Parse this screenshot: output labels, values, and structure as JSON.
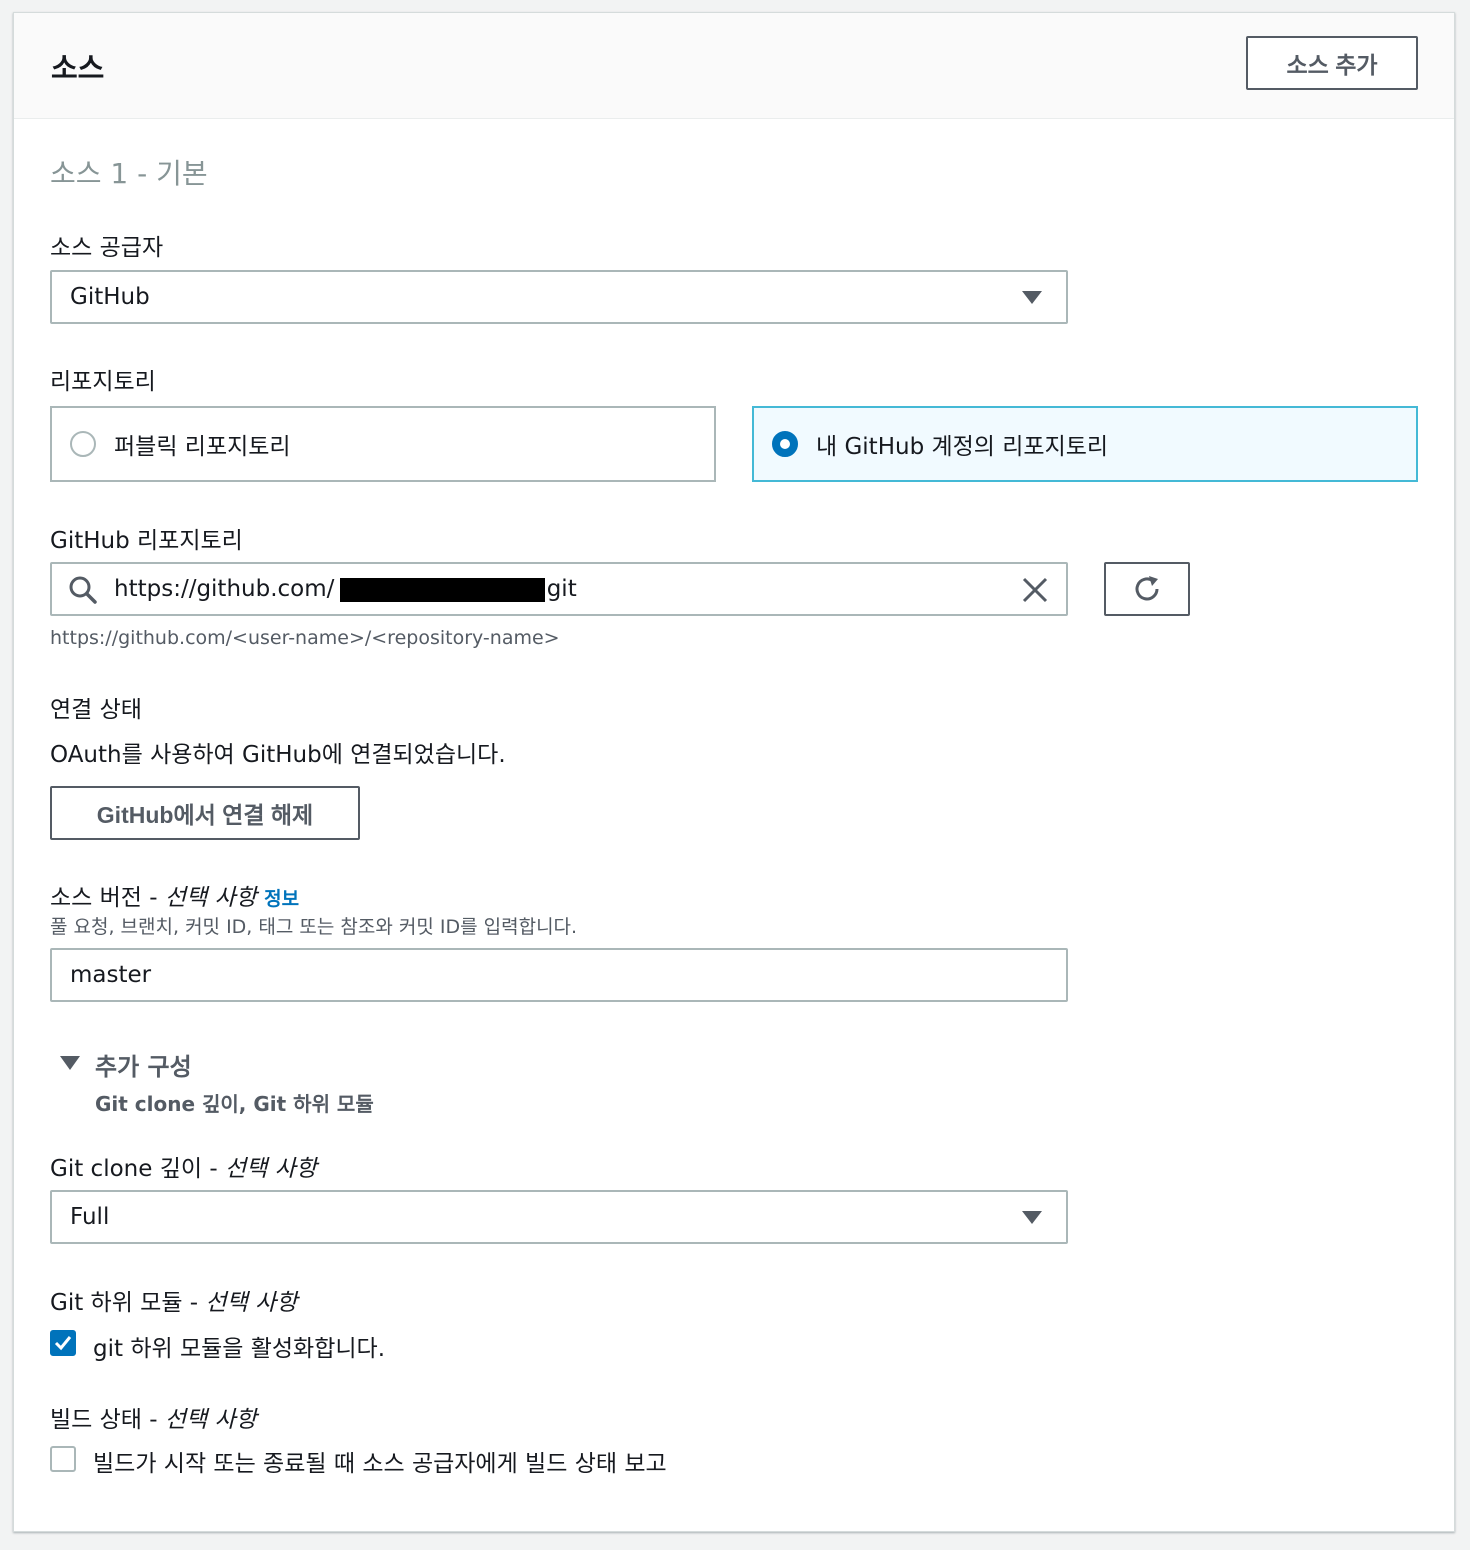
{
  "panel": {
    "title": "소스",
    "add_source_label": "소스 추가"
  },
  "source1": {
    "subtitle": "소스 1 - 기본"
  },
  "provider": {
    "label": "소스 공급자",
    "value": "GitHub"
  },
  "repository": {
    "label": "리포지토리",
    "options": [
      {
        "label": "퍼블릭 리포지토리",
        "selected": false
      },
      {
        "label": "내 GitHub 계정의 리포지토리",
        "selected": true
      }
    ]
  },
  "github_repo": {
    "label": "GitHub 리포지토리",
    "value_prefix": "https://github.com/",
    "value_suffix": ".git",
    "hint": "https://github.com/<user-name>/<repository-name>"
  },
  "connection": {
    "label": "연결 상태",
    "status_text": "OAuth를 사용하여 GitHub에 연결되었습니다.",
    "disconnect_label": "GitHub에서 연결 해제"
  },
  "source_version": {
    "label": "소스 버전 - ",
    "optional": "선택 사항",
    "info_link": "정보",
    "hint": "풀 요청, 브랜치, 커밋 ID, 태그 또는 참조와 커밋 ID를 입력합니다.",
    "value": "master"
  },
  "additional_config": {
    "title": "추가 구성",
    "subtitle": "Git clone 깊이, Git 하위 모듈"
  },
  "clone_depth": {
    "label": "Git clone 깊이 - ",
    "optional": "선택 사항",
    "value": "Full"
  },
  "submodules": {
    "label": "Git 하위 모듈 - ",
    "optional": "선택 사항",
    "checkbox_label": "git 하위 모듈을 활성화합니다.",
    "checked": true
  },
  "build_status": {
    "label": "빌드 상태 - ",
    "optional": "선택 사항",
    "checkbox_label": "빌드가 시작 또는 종료될 때 소스 공급자에게 빌드 상태 보고",
    "checked": false
  },
  "colors": {
    "accent": "#0073bb",
    "selected_border": "#44b9d6",
    "selected_bg": "#f1faff"
  }
}
